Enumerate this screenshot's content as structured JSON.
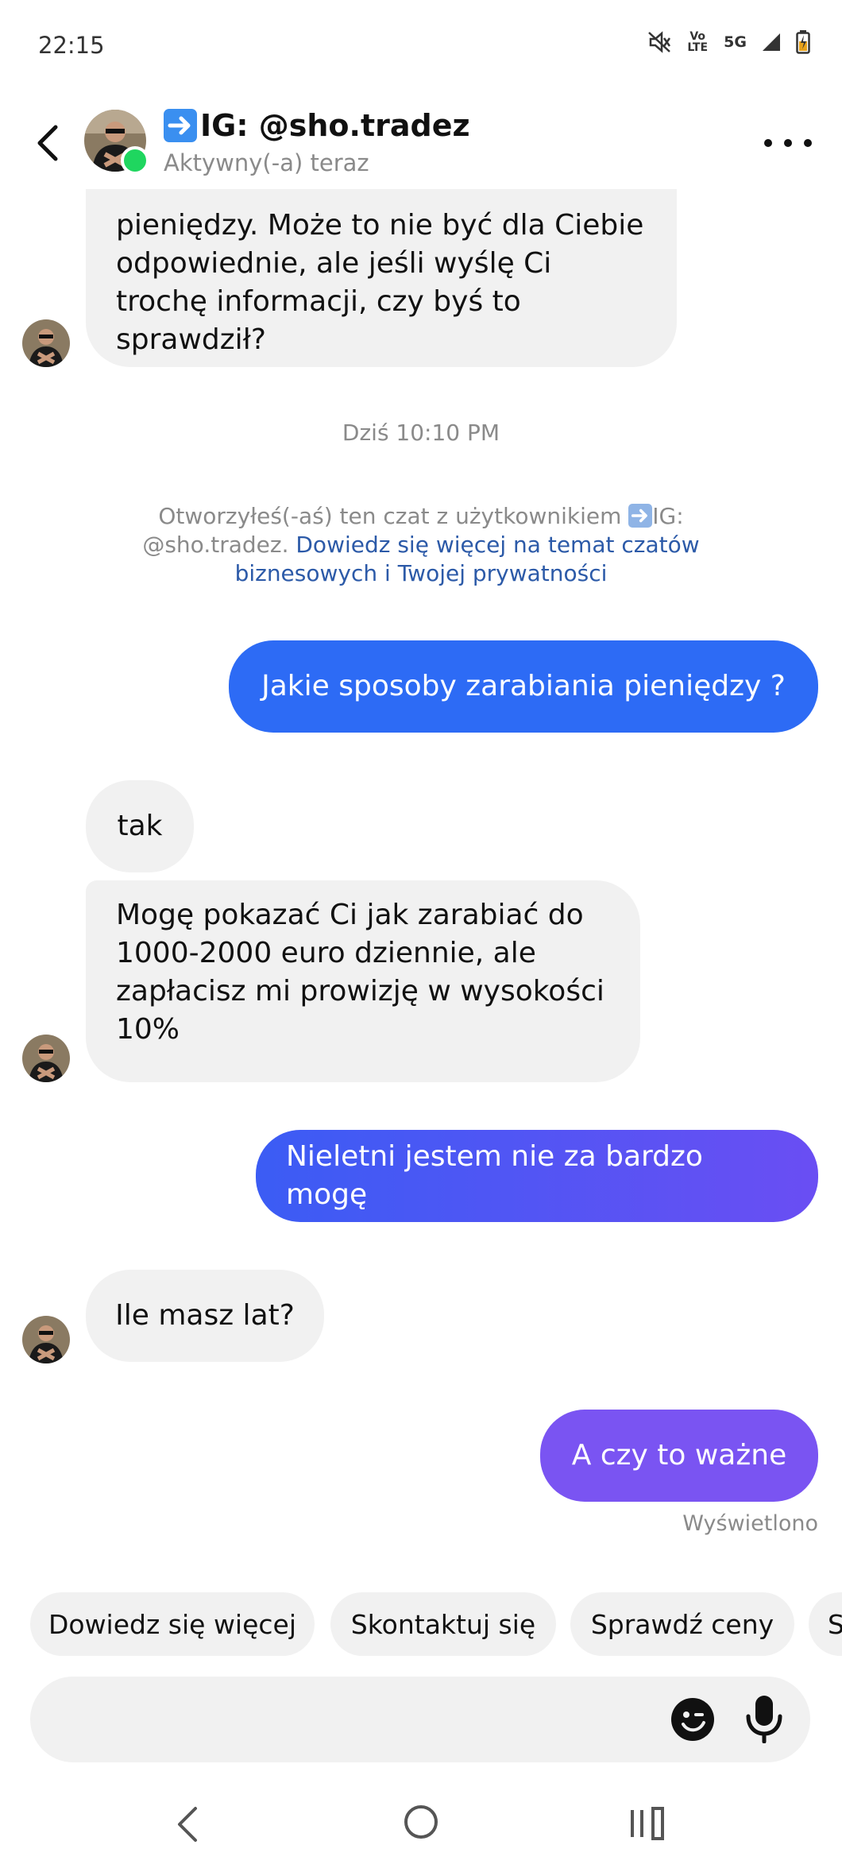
{
  "status_bar": {
    "time": "22:15",
    "volte_label": "Vo LTE",
    "network": "5G"
  },
  "header": {
    "name": "IG: @sho.tradez",
    "status": "Aktywny(-a) teraz"
  },
  "messages": {
    "m1_l1": "pieniędzy. Może to nie być dla Ciebie",
    "m1_l2": "odpowiednie, ale jeśli wyślę Ci",
    "m1_l3": "trochę informacji, czy byś to",
    "m1_l4": "sprawdził?",
    "timestamp": "Dziś 10:10 PM",
    "notice_l1": "Otworzyłeś(-aś) ten czat z użytkownikiem",
    "notice_ig": "IG:",
    "notice_handle": "@sho.tradez.",
    "notice_link_l1": "Dowiedz się więcej na temat czatów",
    "notice_link_l2": "biznesowych i Twojej prywatności",
    "out1": "Jakie sposoby zarabiania pieniędzy ?",
    "in_tak": "tak",
    "in2_l1": "Mogę pokazać Ci jak zarabiać do",
    "in2_l2": "1000-2000 euro dziennie, ale",
    "in2_l3": "zapłacisz mi prowizję w wysokości",
    "in2_l4": "10%",
    "out2": "Nieletni jestem nie za bardzo mogę",
    "in3": "Ile masz lat?",
    "out3": "A czy to ważne",
    "seen": "Wyświetlono"
  },
  "quick_replies": [
    "Dowiedz się więcej",
    "Skontaktuj się",
    "Sprawdź ceny",
    "S"
  ],
  "colors": {
    "bubble_in": "#f1f1f1",
    "out1": "#2d6bf5",
    "out2_start": "#3b5cf4",
    "out2_end": "#6a4ef3",
    "out3": "#7a54f2",
    "link": "#2c5aa8",
    "online": "#1fd65f"
  }
}
